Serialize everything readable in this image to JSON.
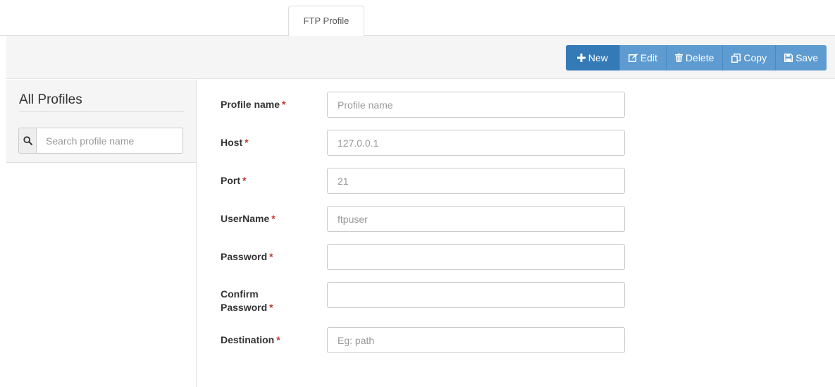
{
  "tabs": [
    {
      "label": "FTP Profile"
    }
  ],
  "toolbar": {
    "new_label": "New",
    "edit_label": "Edit",
    "delete_label": "Delete",
    "copy_label": "Copy",
    "save_label": "Save",
    "accent_color": "#337ab7",
    "soft_color": "#5e9bd0"
  },
  "sidebar": {
    "title": "All Profiles",
    "search_placeholder": "Search profile name"
  },
  "form": {
    "required_mark": "*",
    "fields": [
      {
        "label": "Profile name",
        "value": "",
        "placeholder": "Profile name"
      },
      {
        "label": "Host",
        "value": "",
        "placeholder": "127.0.0.1"
      },
      {
        "label": "Port",
        "value": "",
        "placeholder": "21"
      },
      {
        "label": "UserName",
        "value": "",
        "placeholder": "ftpuser"
      },
      {
        "label": "Password",
        "value": "",
        "placeholder": ""
      },
      {
        "label": "Confirm Password",
        "value": "",
        "placeholder": ""
      },
      {
        "label": "Destination",
        "value": "",
        "placeholder": "Eg: path"
      }
    ]
  }
}
